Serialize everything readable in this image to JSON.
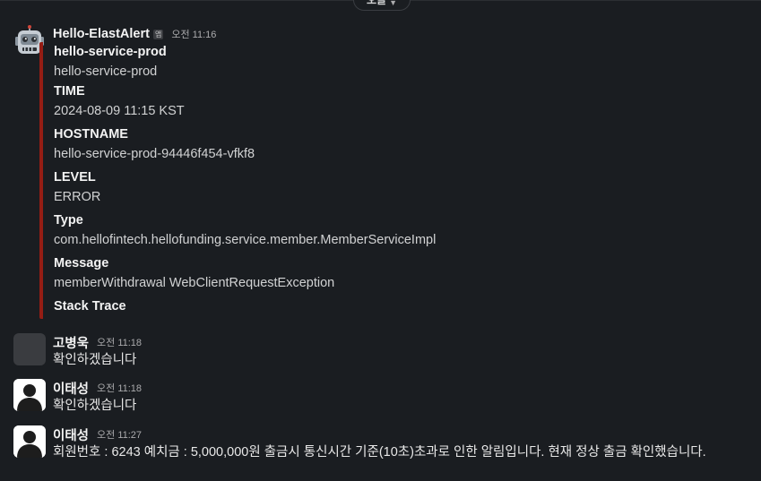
{
  "date_divider": {
    "label": "오늘",
    "chevron": "chevron-down-icon"
  },
  "alert": {
    "author": "Hello-ElastAlert",
    "badge": "앱",
    "time": "오전 11:16",
    "avatar": "robot-icon",
    "accent_color": "#951d14",
    "fields": [
      {
        "title": "hello-service-prod",
        "value": "hello-service-prod"
      },
      {
        "title": "TIME",
        "value": "2024-08-09 11:15 KST"
      },
      {
        "title": "HOSTNAME",
        "value": "hello-service-prod-94446f454-vfkf8"
      },
      {
        "title": "LEVEL",
        "value": "ERROR"
      },
      {
        "title": "Type",
        "value": "com.hellofintech.hellofunding.service.member.MemberServiceImpl"
      },
      {
        "title": "Message",
        "value": "memberWithdrawal WebClientRequestException"
      },
      {
        "title": "Stack Trace",
        "value": ""
      }
    ]
  },
  "messages": [
    {
      "author": "고병욱",
      "time": "오전 11:18",
      "text": "확인하겠습니다",
      "avatar": "blank-avatar"
    },
    {
      "author": "이태성",
      "time": "오전 11:18",
      "text": "확인하겠습니다",
      "avatar": "person-icon"
    },
    {
      "author": "이태성",
      "time": "오전 11:27",
      "text": "회원번호 : 6243 예치금 : 5,000,000원 출금시 통신시간 기준(10초)초과로 인한 알림입니다. 현재 정상 출금 확인했습니다.",
      "avatar": "person-icon"
    }
  ]
}
